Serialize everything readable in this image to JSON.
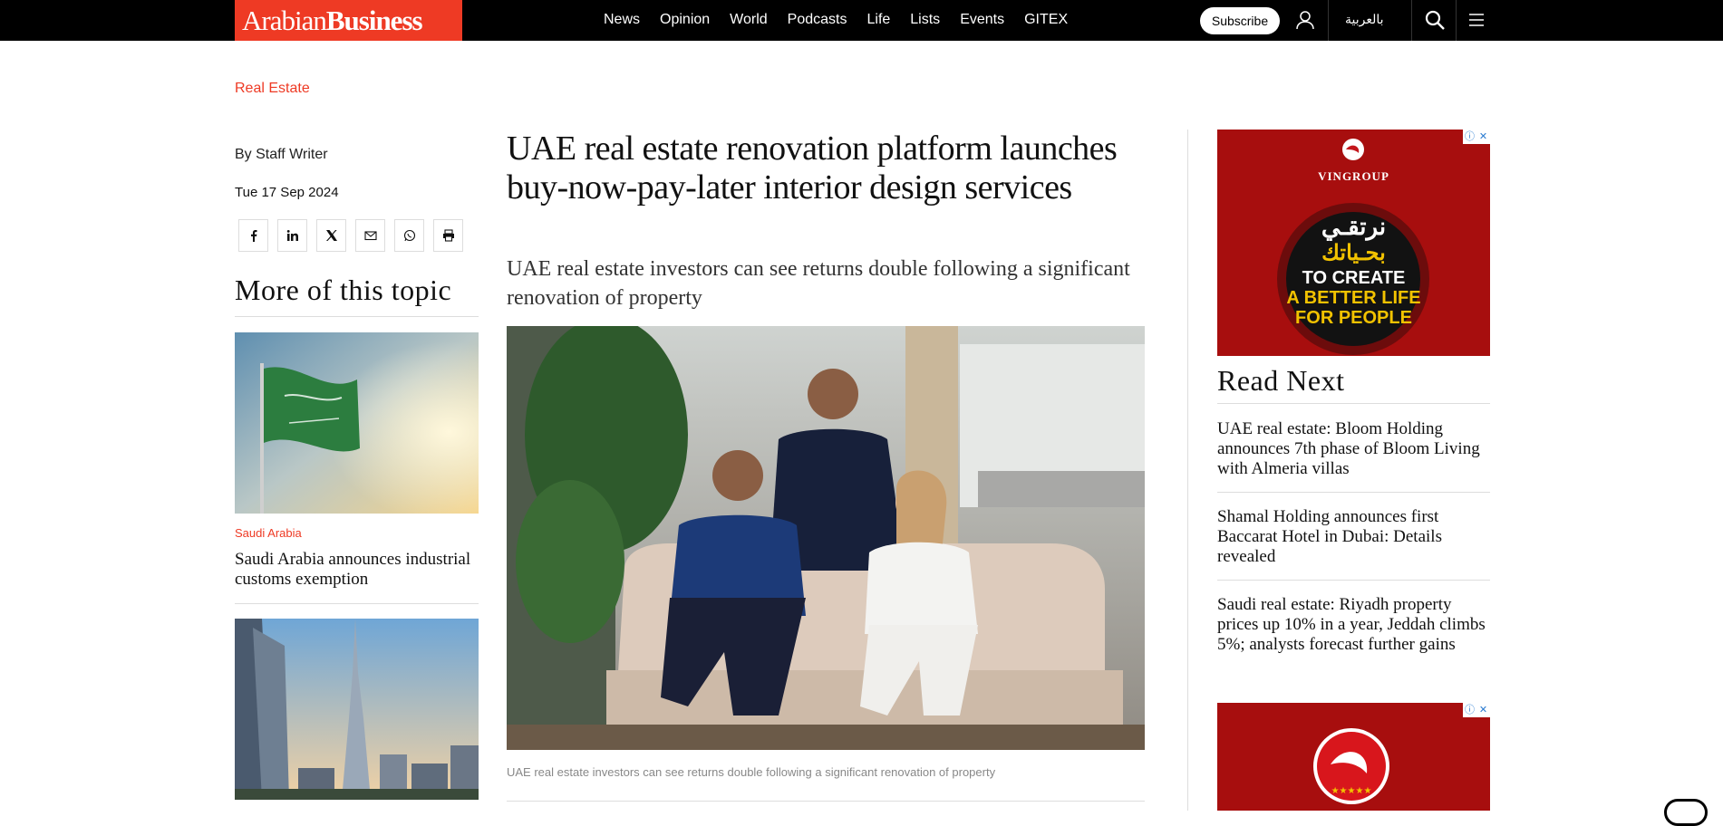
{
  "brand": {
    "name_regular": "Arabian",
    "name_bold": "Business",
    "color": "#ee3a24"
  },
  "nav": {
    "items": [
      "News",
      "Opinion",
      "World",
      "Podcasts",
      "Life",
      "Lists",
      "Events",
      "GITEX"
    ]
  },
  "header": {
    "subscribe_label": "Subscribe",
    "language_label": "بالعربية",
    "icons": [
      "user-icon",
      "search-icon",
      "menu-icon"
    ]
  },
  "article": {
    "section": "Real Estate",
    "byline": "By Staff Writer",
    "date": "Tue 17 Sep 2024",
    "headline": "UAE real estate renovation platform launches buy-now-pay-later interior design services",
    "subheadline": "UAE real estate investors can see returns double following a significant renovation of property",
    "caption": "UAE real estate investors can see returns double following a significant renovation of property",
    "share_icons": [
      "facebook-icon",
      "linkedin-icon",
      "x-icon",
      "email-icon",
      "whatsapp-icon",
      "print-icon"
    ]
  },
  "more_topic": {
    "title": "More of this topic",
    "cards": [
      {
        "category": "Saudi Arabia",
        "title": "Saudi Arabia announces industrial customs exemption"
      }
    ]
  },
  "read_next": {
    "title": "Read Next",
    "items": [
      "UAE real estate: Bloom Holding announces 7th phase of Bloom Living with Almeria villas",
      "Shamal Holding announces first Baccarat Hotel in Dubai: Details revealed",
      "Saudi real estate: Riyadh property prices up 10% in a year, Jeddah climbs 5%; analysts forecast further gains"
    ]
  },
  "ads": {
    "brand": "VINGROUP",
    "arabic_line1": "نرتقـي",
    "arabic_line2": "بحـياتك",
    "english_lines": [
      "TO CREATE",
      "A BETTER LIFE",
      "FOR PEOPLE"
    ],
    "ad_icons": [
      "ad-info-icon",
      "ad-close-icon"
    ]
  }
}
